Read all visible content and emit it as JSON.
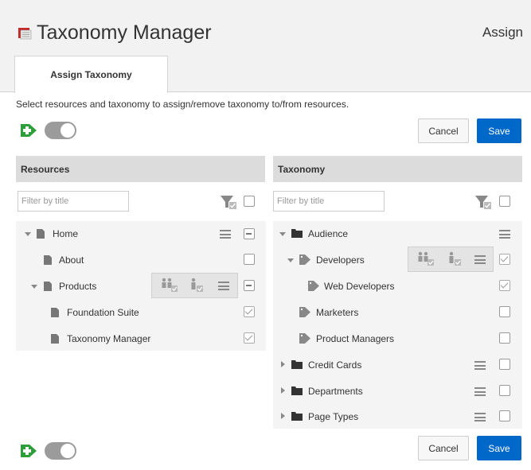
{
  "header": {
    "title": "Taxonomy Manager",
    "assign_link": "Assign"
  },
  "tabs": [
    {
      "label": "Assign Taxonomy"
    }
  ],
  "instructions": "Select resources and taxonomy to assign/remove taxonomy to/from resources.",
  "buttons": {
    "cancel": "Cancel",
    "save": "Save"
  },
  "resources": {
    "title": "Resources",
    "filter_placeholder": "Filter by title",
    "items": [
      {
        "label": "Home",
        "expanded": true,
        "check": "partial"
      },
      {
        "label": "About",
        "check": "none"
      },
      {
        "label": "Products",
        "expanded": true,
        "check": "partial"
      },
      {
        "label": "Foundation Suite",
        "check": "checked"
      },
      {
        "label": "Taxonomy Manager",
        "check": "checked"
      }
    ]
  },
  "taxonomy": {
    "title": "Taxonomy",
    "filter_placeholder": "Filter by title",
    "items": [
      {
        "label": "Audience",
        "expanded": true,
        "check": "none"
      },
      {
        "label": "Developers",
        "expanded": true,
        "check": "checked"
      },
      {
        "label": "Web Developers",
        "check": "checked"
      },
      {
        "label": "Marketers",
        "check": "none"
      },
      {
        "label": "Product Managers",
        "check": "none"
      },
      {
        "label": "Credit Cards",
        "expanded": false,
        "check": "none"
      },
      {
        "label": "Departments",
        "expanded": false,
        "check": "none"
      },
      {
        "label": "Page Types",
        "expanded": false,
        "check": "none"
      }
    ]
  },
  "colors": {
    "primary": "#0068c9",
    "add_green": "#2e9e3a",
    "header_bg": "#f2f2f2"
  },
  "icons": [
    "folder-icon",
    "add-icon",
    "filter-icon",
    "page-icon",
    "tag-icon",
    "hamburger-icon",
    "assign-users-icon",
    "toggle-switch"
  ]
}
